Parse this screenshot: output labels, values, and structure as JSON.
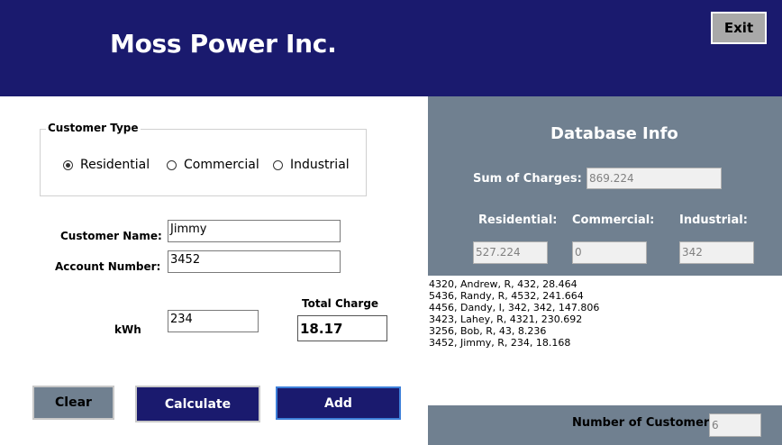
{
  "header": {
    "title": "Moss Power Inc.",
    "exit_label": "Exit"
  },
  "customer_type": {
    "legend": "Customer Type",
    "options": [
      {
        "label": "Residential",
        "selected": true
      },
      {
        "label": "Commercial",
        "selected": false
      },
      {
        "label": "Industrial",
        "selected": false
      }
    ]
  },
  "form": {
    "customer_name_label": "Customer Name:",
    "customer_name_value": "Jimmy",
    "account_number_label": "Account Number:",
    "account_number_value": "3452",
    "kwh_label": "kWh",
    "kwh_value": "234",
    "total_charge_label": "Total Charge",
    "total_charge_value": "18.17"
  },
  "buttons": {
    "clear": "Clear",
    "calculate": "Calculate",
    "add": "Add"
  },
  "database": {
    "title": "Database Info",
    "sum_label": "Sum of Charges:",
    "sum_value": "869.224",
    "residential_label": "Residential:",
    "residential_value": "527.224",
    "commercial_label": "Commercial:",
    "commercial_value": "0",
    "industrial_label": "Industrial:",
    "industrial_value": "342"
  },
  "records": [
    "4320, Andrew, R, 432, 28.464",
    "5436, Randy, R, 4532, 241.664",
    "4456, Dandy, I, 342, 342, 147.806",
    "3423, Lahey, R, 4321, 230.692",
    "3256, Bob, R, 43, 8.236",
    "3452, Jimmy, R, 234, 18.168"
  ],
  "footer": {
    "count_label": "Number of Customers:",
    "count_value": "6"
  },
  "colors": {
    "header": "#1a1a6e",
    "panel": "#708090",
    "button_dark": "#1a1a6e",
    "focus_border": "#3d7fd9"
  }
}
